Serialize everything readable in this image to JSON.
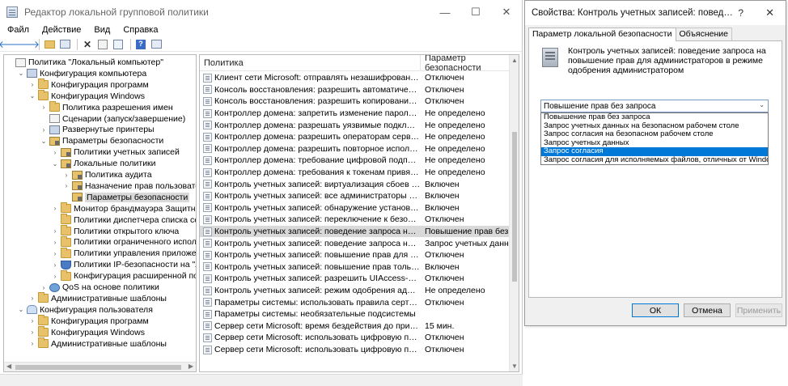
{
  "main_window": {
    "title": "Редактор локальной групповой политики",
    "controls": {
      "minimize": "—",
      "maximize": "☐",
      "close": "✕"
    },
    "menu": [
      "Файл",
      "Действие",
      "Вид",
      "Справка"
    ],
    "toolbar_icons": [
      "back-arrow-icon",
      "forward-arrow-icon",
      "up-folder-icon",
      "show-tree-icon",
      "delete-icon",
      "properties-icon",
      "export-list-icon",
      "help-icon",
      "console-icon"
    ]
  },
  "tree": {
    "rows": [
      {
        "label": "Политика \"Локальный компьютер\"",
        "level": 0,
        "chev": "",
        "icon": "doc"
      },
      {
        "label": "Конфигурация компьютера",
        "level": 1,
        "chev": "v",
        "icon": "computer"
      },
      {
        "label": "Конфигурация программ",
        "level": 2,
        "chev": ">",
        "icon": "folder"
      },
      {
        "label": "Конфигурация Windows",
        "level": 2,
        "chev": "v",
        "icon": "folder"
      },
      {
        "label": "Политика разрешения имен",
        "level": 3,
        "chev": ">",
        "icon": "folder"
      },
      {
        "label": "Сценарии (запуск/завершение)",
        "level": 3,
        "chev": "",
        "icon": "doc"
      },
      {
        "label": "Развернутые принтеры",
        "level": 3,
        "chev": ">",
        "icon": "computer"
      },
      {
        "label": "Параметры безопасности",
        "level": 3,
        "chev": "v",
        "icon": "lock"
      },
      {
        "label": "Политики учетных записей",
        "level": 4,
        "chev": ">",
        "icon": "lock"
      },
      {
        "label": "Локальные политики",
        "level": 4,
        "chev": "v",
        "icon": "lock"
      },
      {
        "label": "Политика аудита",
        "level": 5,
        "chev": ">",
        "icon": "lock"
      },
      {
        "label": "Назначение прав пользователя",
        "level": 5,
        "chev": ">",
        "icon": "lock"
      },
      {
        "label": "Параметры безопасности",
        "level": 5,
        "chev": "",
        "icon": "lock",
        "selected": true
      },
      {
        "label": "Монитор брандмауэра Защитника Wi",
        "level": 4,
        "chev": ">",
        "icon": "folder"
      },
      {
        "label": "Политики диспетчера списка сетей",
        "level": 4,
        "chev": "",
        "icon": "folder"
      },
      {
        "label": "Политики открытого ключа",
        "level": 4,
        "chev": ">",
        "icon": "folder"
      },
      {
        "label": "Политики ограниченного использова",
        "level": 4,
        "chev": ">",
        "icon": "folder"
      },
      {
        "label": "Политики управления приложениями",
        "level": 4,
        "chev": ">",
        "icon": "folder"
      },
      {
        "label": "Политики IP-безопасности на \"Локаль",
        "level": 4,
        "chev": ">",
        "icon": "shield"
      },
      {
        "label": "Конфигурация расширенной политики",
        "level": 4,
        "chev": ">",
        "icon": "folder"
      },
      {
        "label": "QoS на основе политики",
        "level": 3,
        "chev": ">",
        "icon": "globe"
      },
      {
        "label": "Административные шаблоны",
        "level": 2,
        "chev": ">",
        "icon": "folder"
      },
      {
        "label": "Конфигурация пользователя",
        "level": 1,
        "chev": "v",
        "icon": "user"
      },
      {
        "label": "Конфигурация программ",
        "level": 2,
        "chev": ">",
        "icon": "folder"
      },
      {
        "label": "Конфигурация Windows",
        "level": 2,
        "chev": ">",
        "icon": "folder"
      },
      {
        "label": "Административные шаблоны",
        "level": 2,
        "chev": ">",
        "icon": "folder"
      }
    ]
  },
  "list": {
    "headers": {
      "policy": "Политика",
      "setting": "Параметр безопасности"
    },
    "rows": [
      {
        "policy": "Клиент сети Microsoft: отправлять незашифрованный пар...",
        "setting": "Отключен"
      },
      {
        "policy": "Консоль восстановления: разрешить автоматический вход ...",
        "setting": "Отключен"
      },
      {
        "policy": "Консоль восстановления: разрешить копирование дискет ...",
        "setting": "Отключен"
      },
      {
        "policy": "Контроллер домена: запретить изменение пароля учетных...",
        "setting": "Не определено"
      },
      {
        "policy": "Контроллер домена: разрешать уязвимые подключения п...",
        "setting": "Не определено"
      },
      {
        "policy": "Контроллер домена: разрешить операторам сервера задав...",
        "setting": "Не определено"
      },
      {
        "policy": "Контроллер домена: разрешить повторное использование...",
        "setting": "Не определено"
      },
      {
        "policy": "Контроллер домена: требование цифровой подписи для ...",
        "setting": "Не определено"
      },
      {
        "policy": "Контроллер домена: требования к токенам привязки кана...",
        "setting": "Не определено"
      },
      {
        "policy": "Контроль учетных записей: виртуализация сбоев записи в ...",
        "setting": "Включен"
      },
      {
        "policy": "Контроль учетных записей: все администраторы работают...",
        "setting": "Включен"
      },
      {
        "policy": "Контроль учетных записей: обнаружение установки прилож...",
        "setting": "Включен"
      },
      {
        "policy": "Контроль учетных записей: переключение к безопасному ...",
        "setting": "Отключен"
      },
      {
        "policy": "Контроль учетных записей: поведение запроса на повыше...",
        "setting": "Повышение прав без запро",
        "selected": true
      },
      {
        "policy": "Контроль учетных записей: поведение запроса на повыше...",
        "setting": "Запрос учетных данных"
      },
      {
        "policy": "Контроль учетных записей: повышение прав для UIAccess-...",
        "setting": "Отключен"
      },
      {
        "policy": "Контроль учетных записей: повышение прав только для по...",
        "setting": "Включен"
      },
      {
        "policy": "Контроль учетных записей: разрешить UIAccess-приложе...",
        "setting": "Отключен"
      },
      {
        "policy": "Контроль учетных записей: режим одобрения администрат...",
        "setting": "Не определено"
      },
      {
        "policy": "Параметры системы: использовать правила сертификатов ...",
        "setting": "Отключен"
      },
      {
        "policy": "Параметры системы: необязательные подсистемы",
        "setting": ""
      },
      {
        "policy": "Сервер сети Microsoft: время бездействия до приостановк...",
        "setting": "15 мин."
      },
      {
        "policy": "Сервер сети Microsoft: использовать цифровую подпись (в...",
        "setting": "Отключен"
      },
      {
        "policy": "Сервер сети Microsoft: использовать цифровую подпись (с...",
        "setting": "Отключен"
      }
    ]
  },
  "dialog": {
    "title": "Свойства: Контроль учетных записей: поведение запро...",
    "help": "?",
    "close": "✕",
    "tabs": [
      "Параметр локальной безопасности",
      "Объяснение"
    ],
    "description": "Контроль учетных записей: поведение запроса на повышение прав для администраторов в режиме одобрения администратором",
    "combo_value": "Повышение прав без запроса",
    "options": [
      {
        "label": "Повышение прав без запроса"
      },
      {
        "label": "Запрос учетных данных на безопасном рабочем столе"
      },
      {
        "label": "Запрос согласия на безопасном рабочем столе"
      },
      {
        "label": "Запрос учетных данных"
      },
      {
        "label": "Запрос согласия",
        "selected": true
      },
      {
        "label": "Запрос согласия для исполняемых файлов, отличных от Windows"
      }
    ],
    "buttons": {
      "ok": "ОК",
      "cancel": "Отмена",
      "apply": "Применить"
    }
  },
  "colors": {
    "accent": "#0078d7",
    "selection_gray": "#d9d9d9"
  }
}
